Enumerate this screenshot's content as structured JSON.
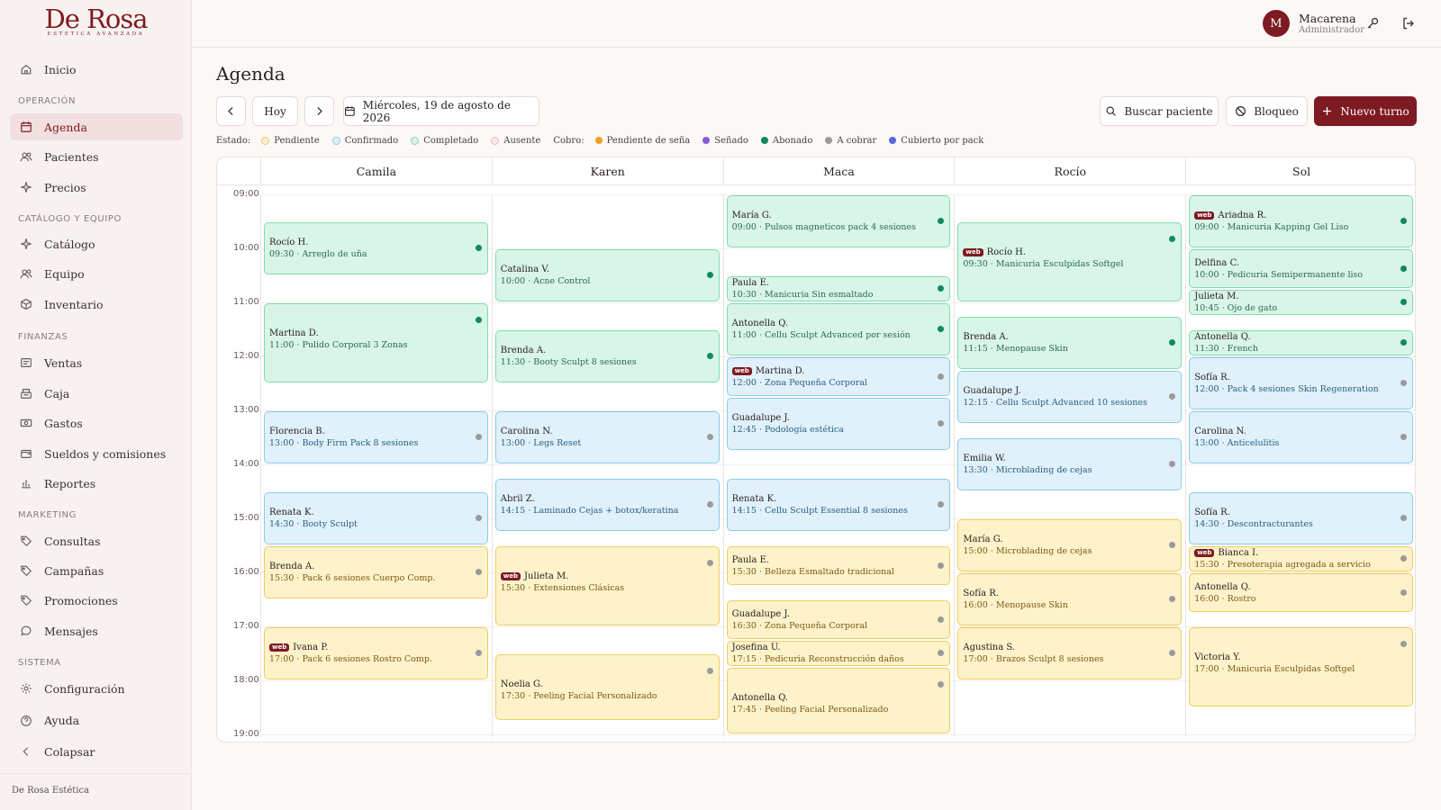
{
  "brand": {
    "name": "De Rosa",
    "tagline": "ESTÉTICA AVANZADA",
    "footer": "De Rosa Estética"
  },
  "nav": {
    "items": [
      {
        "label": "Inicio",
        "icon": "home-icon",
        "name": "inicio"
      },
      {
        "label": "Agenda",
        "icon": "calendar-icon",
        "name": "agenda"
      },
      {
        "label": "Pacientes",
        "icon": "users-icon",
        "name": "pacientes"
      },
      {
        "label": "Precios",
        "icon": "sparkle-icon",
        "name": "precios"
      },
      {
        "label": "Catálogo",
        "icon": "sparkle-icon",
        "name": "catalogo"
      },
      {
        "label": "Equipo",
        "icon": "users-icon",
        "name": "equipo"
      },
      {
        "label": "Inventario",
        "icon": "box-icon",
        "name": "inventario"
      },
      {
        "label": "Ventas",
        "icon": "receipt-icon",
        "name": "ventas"
      },
      {
        "label": "Caja",
        "icon": "register-icon",
        "name": "caja"
      },
      {
        "label": "Gastos",
        "icon": "banknote-icon",
        "name": "gastos"
      },
      {
        "label": "Sueldos y comisiones",
        "icon": "wallet-icon",
        "name": "sueldos"
      },
      {
        "label": "Reportes",
        "icon": "bar-chart-icon",
        "name": "reportes"
      },
      {
        "label": "Consultas",
        "icon": "tag-icon",
        "name": "consultas"
      },
      {
        "label": "Campañas",
        "icon": "tag-icon",
        "name": "campanas"
      },
      {
        "label": "Promociones",
        "icon": "tag-icon",
        "name": "promociones"
      },
      {
        "label": "Mensajes",
        "icon": "message-icon",
        "name": "mensajes"
      },
      {
        "label": "Configuración",
        "icon": "gear-icon",
        "name": "configuracion"
      },
      {
        "label": "Ayuda",
        "icon": "help-icon",
        "name": "ayuda"
      },
      {
        "label": "Colapsar",
        "icon": "chevron-left-icon",
        "name": "colapsar"
      }
    ],
    "sections": [
      "OPERACIÓN",
      "CATÁLOGO Y EQUIPO",
      "FINANZAS",
      "MARKETING",
      "SISTEMA"
    ]
  },
  "user": {
    "initial": "M",
    "name": "Macarena",
    "role": "Administrador"
  },
  "page": {
    "title": "Agenda"
  },
  "toolbar": {
    "today": "Hoy",
    "date": "Miércoles, 19 de agosto de 2026",
    "search": "Buscar paciente",
    "block": "Bloqueo",
    "new": "Nuevo turno"
  },
  "legend": {
    "estado_label": "Estado:",
    "estado": [
      {
        "label": "Pendiente",
        "color": "#f0cd63"
      },
      {
        "label": "Confirmado",
        "color": "#8ccbea"
      },
      {
        "label": "Completado",
        "color": "#7fdcb0"
      },
      {
        "label": "Ausente",
        "color": "#f2b8b8"
      }
    ],
    "cobro_label": "Cobro:",
    "cobro": [
      {
        "label": "Pendiente de seña",
        "color": "#f0a020"
      },
      {
        "label": "Señado",
        "color": "#8a5ad8"
      },
      {
        "label": "Abonado",
        "color": "#0f8a5a"
      },
      {
        "label": "A cobrar",
        "color": "#9a9a9a"
      },
      {
        "label": "Cubierto por pack",
        "color": "#5a66e0"
      }
    ]
  },
  "times": [
    "09:00",
    "10:00",
    "11:00",
    "12:00",
    "13:00",
    "14:00",
    "15:00",
    "16:00",
    "17:00",
    "18:00",
    "19:00"
  ],
  "staff": [
    {
      "name": "Camila",
      "appointments": [
        {
          "patient": "Rocío H.",
          "start": "09:30",
          "end": "10:30",
          "service": "Arreglo de uña",
          "status": "completado",
          "cobro": "abonado",
          "web": false
        },
        {
          "patient": "Martina D.",
          "start": "11:00",
          "end": "12:30",
          "service": "Pulido Corporal 3 Zonas",
          "status": "completado",
          "cobro": "abonado",
          "web": false
        },
        {
          "patient": "Florencia B.",
          "start": "13:00",
          "end": "14:00",
          "service": "Body Firm Pack 8 sesiones",
          "status": "confirmado",
          "cobro": "a cobrar",
          "web": false
        },
        {
          "patient": "Renata K.",
          "start": "14:30",
          "end": "15:30",
          "service": "Booty Sculpt",
          "status": "confirmado",
          "cobro": "a cobrar",
          "web": false
        },
        {
          "patient": "Brenda A.",
          "start": "15:30",
          "end": "16:30",
          "service": "Pack 6 sesiones Cuerpo Comp.",
          "status": "pendiente",
          "cobro": "a cobrar",
          "web": false
        },
        {
          "patient": "Ivana P.",
          "start": "17:00",
          "end": "18:00",
          "service": "Pack 6 sesiones Rostro Comp.",
          "status": "pendiente",
          "cobro": "a cobrar",
          "web": true
        }
      ]
    },
    {
      "name": "Karen",
      "appointments": [
        {
          "patient": "Catalina V.",
          "start": "10:00",
          "end": "11:00",
          "service": "Acne Control",
          "status": "completado",
          "cobro": "abonado",
          "web": false
        },
        {
          "patient": "Brenda A.",
          "start": "11:30",
          "end": "12:30",
          "service": "Booty Sculpt 8 sesiones",
          "status": "completado",
          "cobro": "abonado",
          "web": false
        },
        {
          "patient": "Carolina N.",
          "start": "13:00",
          "end": "14:00",
          "service": "Legs Reset",
          "status": "confirmado",
          "cobro": "a cobrar",
          "web": false
        },
        {
          "patient": "Abril Z.",
          "start": "14:15",
          "end": "15:15",
          "service": "Laminado Cejas + botox/keratina",
          "status": "confirmado",
          "cobro": "a cobrar",
          "web": false
        },
        {
          "patient": "Julieta M.",
          "start": "15:30",
          "end": "17:00",
          "service": "Extensiones Clásicas",
          "status": "pendiente",
          "cobro": "a cobrar",
          "web": true
        },
        {
          "patient": "Noelia G.",
          "start": "17:30",
          "end": "18:45",
          "service": "Peeling Facial Personalizado",
          "status": "pendiente",
          "cobro": "a cobrar",
          "web": false
        }
      ]
    },
    {
      "name": "Maca",
      "appointments": [
        {
          "patient": "María G.",
          "start": "09:00",
          "end": "10:00",
          "service": "Pulsos magneticos pack 4 sesiones",
          "status": "completado",
          "cobro": "abonado",
          "web": false
        },
        {
          "patient": "Paula E.",
          "start": "10:30",
          "end": "11:00",
          "service": "Manicuria Sin esmaltado",
          "status": "completado",
          "cobro": "abonado",
          "web": false
        },
        {
          "patient": "Antonella Q.",
          "start": "11:00",
          "end": "12:00",
          "service": "Cellu Sculpt Advanced por sesión",
          "status": "completado",
          "cobro": "abonado",
          "web": false
        },
        {
          "patient": "Martina D.",
          "start": "12:00",
          "end": "12:45",
          "service": "Zona Pequeña Corporal",
          "status": "confirmado",
          "cobro": "a cobrar",
          "web": true
        },
        {
          "patient": "Guadalupe J.",
          "start": "12:45",
          "end": "13:45",
          "service": "Podología estética",
          "status": "confirmado",
          "cobro": "a cobrar",
          "web": false
        },
        {
          "patient": "Renata K.",
          "start": "14:15",
          "end": "15:15",
          "service": "Cellu Sculpt Essential 8 sesiones",
          "status": "confirmado",
          "cobro": "a cobrar",
          "web": false
        },
        {
          "patient": "Paula E.",
          "start": "15:30",
          "end": "16:15",
          "service": "Belleza Esmaltado tradicional",
          "status": "pendiente",
          "cobro": "a cobrar",
          "web": false
        },
        {
          "patient": "Guadalupe J.",
          "start": "16:30",
          "end": "17:15",
          "service": "Zona Pequeña Corporal",
          "status": "pendiente",
          "cobro": "a cobrar",
          "web": false
        },
        {
          "patient": "Josefina U.",
          "start": "17:15",
          "end": "17:45",
          "service": "Pedicuria Reconstrucción daños",
          "status": "pendiente",
          "cobro": "a cobrar",
          "web": false
        },
        {
          "patient": "Antonella Q.",
          "start": "17:45",
          "end": "19:00",
          "service": "Peeling Facial Personalizado",
          "status": "pendiente",
          "cobro": "a cobrar",
          "web": false
        }
      ]
    },
    {
      "name": "Rocío",
      "appointments": [
        {
          "patient": "Rocío H.",
          "start": "09:30",
          "end": "11:00",
          "service": "Manicuria Esculpidas Softgel",
          "status": "completado",
          "cobro": "abonado",
          "web": true
        },
        {
          "patient": "Brenda A.",
          "start": "11:15",
          "end": "12:15",
          "service": "Menopause Skin",
          "status": "completado",
          "cobro": "abonado",
          "web": false
        },
        {
          "patient": "Guadalupe J.",
          "start": "12:15",
          "end": "13:15",
          "service": "Cellu Sculpt Advanced 10 sesiones",
          "status": "confirmado",
          "cobro": "a cobrar",
          "web": false
        },
        {
          "patient": "Emilia W.",
          "start": "13:30",
          "end": "14:30",
          "service": "Microblading de cejas",
          "status": "confirmado",
          "cobro": "a cobrar",
          "web": false
        },
        {
          "patient": "María G.",
          "start": "15:00",
          "end": "16:00",
          "service": "Microblading de cejas",
          "status": "pendiente",
          "cobro": "a cobrar",
          "web": false
        },
        {
          "patient": "Sofía R.",
          "start": "16:00",
          "end": "17:00",
          "service": "Menopause Skin",
          "status": "pendiente",
          "cobro": "a cobrar",
          "web": false
        },
        {
          "patient": "Agustina S.",
          "start": "17:00",
          "end": "18:00",
          "service": "Brazos Sculpt 8 sesiones",
          "status": "pendiente",
          "cobro": "a cobrar",
          "web": false
        }
      ]
    },
    {
      "name": "Sol",
      "appointments": [
        {
          "patient": "Ariadna R.",
          "start": "09:00",
          "end": "10:00",
          "service": "Manicuria Kapping Gel Liso",
          "status": "completado",
          "cobro": "abonado",
          "web": true
        },
        {
          "patient": "Delfina C.",
          "start": "10:00",
          "end": "10:45",
          "service": "Pedicuria Semipermanente liso",
          "status": "completado",
          "cobro": "abonado",
          "web": false
        },
        {
          "patient": "Julieta M.",
          "start": "10:45",
          "end": "11:15",
          "service": "Ojo de gato",
          "status": "completado",
          "cobro": "abonado",
          "web": false
        },
        {
          "patient": "Antonella Q.",
          "start": "11:30",
          "end": "12:00",
          "service": "French",
          "status": "completado",
          "cobro": "abonado",
          "web": false
        },
        {
          "patient": "Sofía R.",
          "start": "12:00",
          "end": "13:00",
          "service": "Pack 4 sesiones Skin Regeneration",
          "status": "confirmado",
          "cobro": "a cobrar",
          "web": false
        },
        {
          "patient": "Carolina N.",
          "start": "13:00",
          "end": "14:00",
          "service": "Anticelulitis",
          "status": "confirmado",
          "cobro": "a cobrar",
          "web": false
        },
        {
          "patient": "Sofía R.",
          "start": "14:30",
          "end": "15:30",
          "service": "Descontracturantes",
          "status": "confirmado",
          "cobro": "a cobrar",
          "web": false
        },
        {
          "patient": "Bianca I.",
          "start": "15:30",
          "end": "16:00",
          "service": "Presoterapia agregada a servicio",
          "status": "pendiente",
          "cobro": "a cobrar",
          "web": true
        },
        {
          "patient": "Antonella Q.",
          "start": "16:00",
          "end": "16:45",
          "service": "Rostro",
          "status": "pendiente",
          "cobro": "a cobrar",
          "web": false
        },
        {
          "patient": "Victoria Y.",
          "start": "17:00",
          "end": "18:30",
          "service": "Manicuria Esculpidas Softgel",
          "status": "pendiente",
          "cobro": "a cobrar",
          "web": false
        }
      ]
    }
  ]
}
